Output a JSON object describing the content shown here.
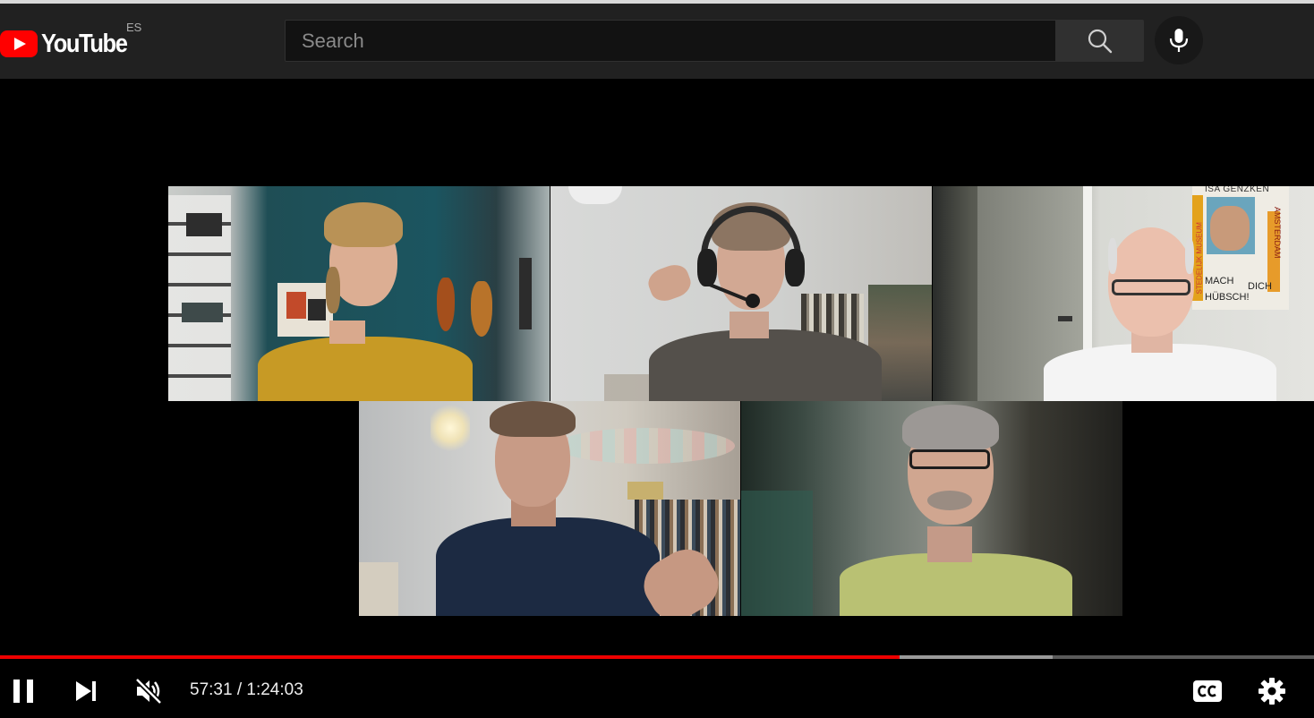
{
  "header": {
    "logo_text": "YouTube",
    "country_code": "ES",
    "search_placeholder": "Search",
    "search_icon": "search-icon",
    "mic_icon": "microphone-icon"
  },
  "video": {
    "participants_count": 5,
    "poster_text": {
      "top": "ISA GENZKEN",
      "side_left": "STEDELIJK MUSEUM",
      "side_right": "AMSTERDAM",
      "mach": "MACH",
      "dich": "DICH",
      "hubsch": "HÜBSCH!"
    }
  },
  "player": {
    "current_time": "57:31",
    "separator": "/",
    "duration": "1:24:03",
    "progress_fraction": 0.6843,
    "icons": {
      "pause": "pause-icon",
      "next": "next-icon",
      "mute": "volume-muted-icon",
      "captions": "captions-icon",
      "settings": "gear-icon"
    },
    "colors": {
      "played": "#ee0000",
      "buffered": "#9a9a9a"
    }
  }
}
